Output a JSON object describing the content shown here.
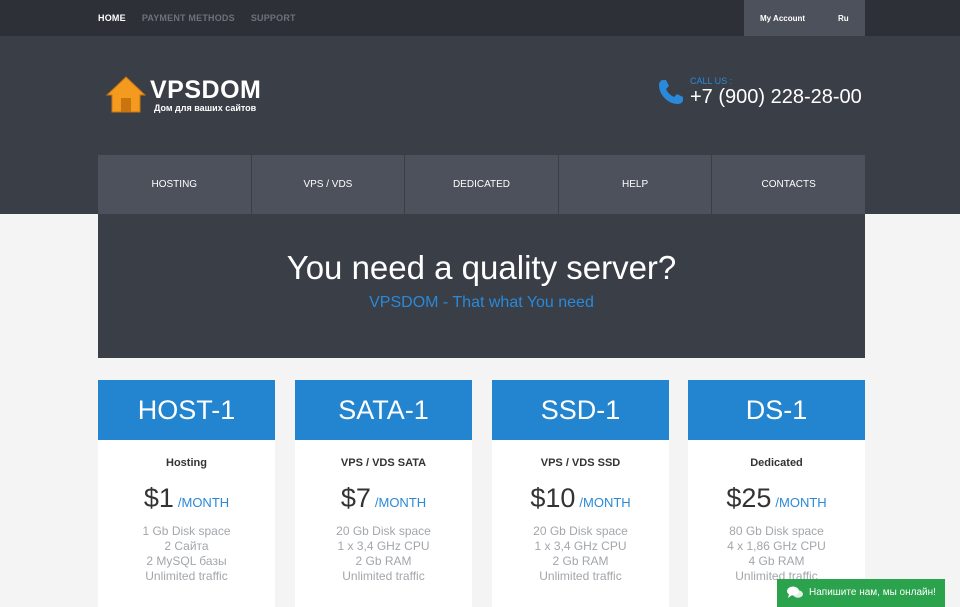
{
  "topbar": {
    "links": [
      {
        "label": "HOME",
        "active": true
      },
      {
        "label": "PAYMENT METHODS",
        "active": false
      },
      {
        "label": "SUPPORT",
        "active": false
      }
    ],
    "account_label": "My Account",
    "language": "Ru"
  },
  "header": {
    "brand": "VPSDOM",
    "tagline": "Дом для ваших сайтов",
    "call_label": "CALL US :",
    "phone": "+7 (900) 228-28-00"
  },
  "nav": {
    "items": [
      "HOSTING",
      "VPS / VDS",
      "DEDICATED",
      "HELP",
      "CONTACTS"
    ]
  },
  "hero": {
    "title": "You need a quality server?",
    "subtitle": "VPSDOM - That what You need"
  },
  "plans": [
    {
      "name": "HOST-1",
      "type": "Hosting",
      "price": "$1",
      "period": "/MONTH",
      "features": [
        "1 Gb Disk space",
        "2 Сайта",
        "2 MySQL базы",
        "Unlimited traffic"
      ]
    },
    {
      "name": "SATA-1",
      "type": "VPS / VDS SATA",
      "price": "$7",
      "period": "/MONTH",
      "features": [
        "20 Gb Disk space",
        "1 x 3,4 GHz CPU",
        "2 Gb RAM",
        "Unlimited traffic"
      ]
    },
    {
      "name": "SSD-1",
      "type": "VPS / VDS SSD",
      "price": "$10",
      "period": "/MONTH",
      "features": [
        "20 Gb Disk space",
        "1 x 3,4 GHz CPU",
        "2 Gb RAM",
        "Unlimited traffic"
      ]
    },
    {
      "name": "DS-1",
      "type": "Dedicated",
      "price": "$25",
      "period": "/MONTH",
      "features": [
        "80 Gb Disk space",
        "4 x 1,86 GHz CPU",
        "4 Gb RAM",
        "Unlimited traffic"
      ]
    }
  ],
  "chat": {
    "label": "Напишите нам, мы онлайн!",
    "icon": "chat-bubbles-icon"
  },
  "colors": {
    "accent": "#2384cf",
    "header_bg": "#3a3e47",
    "chat_green": "#2ba24c",
    "logo_orange": "#f39a1f"
  }
}
